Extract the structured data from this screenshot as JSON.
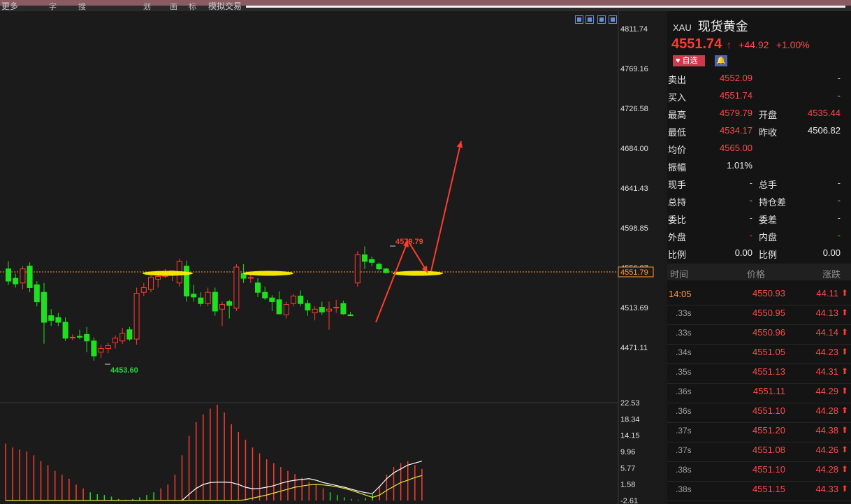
{
  "toolbar": {
    "items": [
      "更多",
      "字",
      "搜",
      "划",
      "画",
      "标",
      "模拟交易"
    ]
  },
  "header": {
    "code": "XAU",
    "name": "现货黄金",
    "price": "4551.74",
    "change": "+44.92",
    "change_pct": "+1.00%",
    "watch_label": "自选",
    "bell_icon": "bell-icon",
    "up_icon": "arrow-up-icon"
  },
  "quotes": [
    {
      "k1": "卖出",
      "v1": "4552.09",
      "k2": "",
      "v2": "-"
    },
    {
      "k1": "买入",
      "v1": "4551.74",
      "k2": "",
      "v2": "-"
    },
    {
      "k1": "最高",
      "v1": "4579.79",
      "k2": "开盘",
      "v2": "4535.44"
    },
    {
      "k1": "最低",
      "v1": "4534.17",
      "k2": "昨收",
      "v2": "4506.82"
    },
    {
      "k1": "均价",
      "v1": "4565.00",
      "k2": "",
      "v2": ""
    },
    {
      "k1": "振幅",
      "v1": "1.01%",
      "k2": "",
      "v2": ""
    },
    {
      "k1": "现手",
      "v1": "-",
      "k2": "总手",
      "v2": "-"
    },
    {
      "k1": "总持",
      "v1": "-",
      "k2": "持仓差",
      "v2": "-"
    },
    {
      "k1": "委比",
      "v1": "-",
      "k2": "委差",
      "v2": "-"
    },
    {
      "k1": "外盘",
      "v1": "-",
      "k2": "内盘",
      "v2": "-"
    },
    {
      "k1": "比例",
      "v1": "0.00",
      "k2": "比例",
      "v2": "0.00"
    }
  ],
  "ticks_header": {
    "time": "时间",
    "price": "价格",
    "change": "涨跌"
  },
  "ticks": [
    {
      "time": "14:05",
      "price": "4550.93",
      "change": "44.11"
    },
    {
      "time": ".33s",
      "price": "4550.95",
      "change": "44.13"
    },
    {
      "time": ".33s",
      "price": "4550.96",
      "change": "44.14"
    },
    {
      "time": ".34s",
      "price": "4551.05",
      "change": "44.23"
    },
    {
      "time": ".35s",
      "price": "4551.13",
      "change": "44.31"
    },
    {
      "time": ".36s",
      "price": "4551.11",
      "change": "44.29"
    },
    {
      "time": ".36s",
      "price": "4551.10",
      "change": "44.28"
    },
    {
      "time": ".37s",
      "price": "4551.20",
      "change": "44.38"
    },
    {
      "time": ".37s",
      "price": "4551.08",
      "change": "44.26"
    },
    {
      "time": ".38s",
      "price": "4551.10",
      "change": "44.28"
    },
    {
      "time": ".38s",
      "price": "4551.15",
      "change": "44.33"
    }
  ],
  "chart_data": [
    {
      "type": "candlestick",
      "y_ticks": [
        "4811.74",
        "4769.16",
        "4726.58",
        "4684.00",
        "4641.43",
        "4598.85",
        "4556.27",
        "4513.69",
        "4471.11"
      ],
      "ylim": [
        4450,
        4815
      ],
      "current_price_label": "4551.79",
      "high_label": "4579.79",
      "low_label": "4453.60",
      "colors": {
        "up": "#ff3b30",
        "down": "#1fe01f",
        "background": "#1b1b1b",
        "highlight": "#ffee00"
      },
      "candles": [
        [
          4555,
          4563,
          4538,
          4542
        ],
        [
          4545,
          4550,
          4535,
          4539
        ],
        [
          4540,
          4558,
          4533,
          4555
        ],
        [
          4558,
          4562,
          4530,
          4535
        ],
        [
          4538,
          4542,
          4515,
          4520
        ],
        [
          4530,
          4540,
          4475,
          4498
        ],
        [
          4505,
          4512,
          4494,
          4500
        ],
        [
          4503,
          4508,
          4494,
          4498
        ],
        [
          4498,
          4503,
          4478,
          4481
        ],
        [
          4482,
          4485,
          4479,
          4482
        ],
        [
          4483,
          4490,
          4480,
          4482
        ],
        [
          4485,
          4493,
          4466,
          4478
        ],
        [
          4478,
          4482,
          4457,
          4462
        ],
        [
          4466,
          4474,
          4460,
          4470
        ],
        [
          4470,
          4476,
          4465,
          4473
        ],
        [
          4476,
          4484,
          4470,
          4481
        ],
        [
          4478,
          4492,
          4475,
          4486
        ],
        [
          4490,
          4493,
          4478,
          4480
        ],
        [
          4480,
          4535,
          4474,
          4529
        ],
        [
          4530,
          4540,
          4526,
          4535
        ],
        [
          4533,
          4548,
          4530,
          4546
        ],
        [
          4544,
          4552,
          4535,
          4547
        ],
        [
          4547,
          4555,
          4545,
          4548
        ],
        [
          4549,
          4553,
          4542,
          4553
        ],
        [
          4540,
          4566,
          4536,
          4563
        ],
        [
          4558,
          4564,
          4520,
          4526
        ],
        [
          4528,
          4538,
          4520,
          4525
        ],
        [
          4524,
          4530,
          4515,
          4518
        ],
        [
          4518,
          4535,
          4515,
          4530
        ],
        [
          4530,
          4535,
          4505,
          4510
        ],
        [
          4512,
          4520,
          4494,
          4517
        ],
        [
          4520,
          4522,
          4502,
          4516
        ],
        [
          4513,
          4560,
          4510,
          4557
        ],
        [
          4550,
          4560,
          4540,
          4545
        ],
        [
          4545,
          4550,
          4540,
          4546
        ],
        [
          4540,
          4545,
          4525,
          4530
        ],
        [
          4530,
          4536,
          4522,
          4524
        ],
        [
          4524,
          4527,
          4510,
          4520
        ],
        [
          4522,
          4531,
          4510,
          4507
        ],
        [
          4506,
          4520,
          4502,
          4517
        ],
        [
          4518,
          4528,
          4515,
          4526
        ],
        [
          4526,
          4532,
          4515,
          4518
        ],
        [
          4518,
          4522,
          4505,
          4511
        ],
        [
          4508,
          4515,
          4500,
          4512
        ],
        [
          4514,
          4520,
          4506,
          4509
        ],
        [
          4510,
          4520,
          4490,
          4512
        ],
        [
          4514,
          4522,
          4508,
          4514
        ],
        [
          4518,
          4521,
          4506,
          4507
        ],
        [
          4506,
          4509,
          4505,
          4505
        ],
        [
          4540,
          4574,
          4536,
          4570
        ],
        [
          4570,
          4579,
          4555,
          4563
        ],
        [
          4565,
          4568,
          4558,
          4562
        ],
        [
          4560,
          4562,
          4553,
          4555
        ],
        [
          4555,
          4556,
          4550,
          4551
        ]
      ]
    },
    {
      "type": "macd",
      "y_ticks": [
        "22.53",
        "18.34",
        "14.15",
        "9.96",
        "5.77",
        "1.58",
        "-2.61"
      ],
      "ylim": [
        -2.61,
        22.53
      ],
      "bars": [
        12,
        11,
        10.5,
        10,
        9,
        7.5,
        6.5,
        5,
        4,
        3,
        1.5,
        0.5,
        -0.5,
        -1,
        -1.2,
        -1.6,
        -2.2,
        -2.4,
        -2.2,
        -1.8,
        -1.2,
        -0.5,
        0.5,
        1.5,
        4,
        9,
        14,
        17.5,
        19.5,
        21,
        22,
        20,
        17,
        15,
        13,
        11,
        9.5,
        8,
        7,
        6,
        5,
        4.2,
        3.2,
        2.2,
        1.5,
        0.5,
        -0.5,
        -1.2,
        -1.8,
        -2.2,
        -2.4,
        -2,
        -1,
        1,
        4,
        6,
        7,
        7.5,
        6.5,
        5.5
      ],
      "dif": [
        -2.6,
        -2.6,
        -2.6,
        -2.6,
        -2.6,
        -2.6,
        -2.6,
        -2.6,
        -2.6,
        -2.6,
        -2.6,
        -2.6,
        -2.6,
        -2.6,
        -2.6,
        -2.6,
        -2.6,
        -2.6,
        -2.6,
        -2.6,
        -2.6,
        -2.6,
        -2.6,
        -2.6,
        -2.6,
        -2.6,
        -1,
        0.5,
        1.5,
        2,
        2.1,
        2.1,
        2,
        1.5,
        0.8,
        0.4,
        0.5,
        0.8,
        1.2,
        1.8,
        2.3,
        2.6,
        2.8,
        3,
        2.6,
        2,
        1.6,
        1.2,
        0.8,
        0.3,
        -0.2,
        -0.6,
        -0.8,
        1,
        3,
        4.5,
        5.5,
        6.5,
        7,
        7.5
      ],
      "dea": [
        -2.6,
        -2.6,
        -2.6,
        -2.6,
        -2.6,
        -2.6,
        -2.6,
        -2.6,
        -2.6,
        -2.6,
        -2.6,
        -2.6,
        -2.6,
        -2.6,
        -2.6,
        -2.6,
        -2.6,
        -2.6,
        -2.6,
        -2.6,
        -2.6,
        -2.6,
        -2.6,
        -2.6,
        -2.6,
        -2.6,
        -2.6,
        -2.6,
        -2.6,
        -2.6,
        -2.6,
        -2.6,
        -2.6,
        -2.6,
        -2.4,
        -2,
        -1.6,
        -1.2,
        -0.7,
        -0.2,
        0.3,
        0.8,
        1.1,
        1.4,
        1.5,
        1.4,
        1.2,
        0.9,
        0.5,
        0,
        -0.6,
        -1.2,
        -1.8,
        -1.2,
        0,
        1,
        2,
        2.6,
        3.3,
        3.8
      ]
    }
  ]
}
